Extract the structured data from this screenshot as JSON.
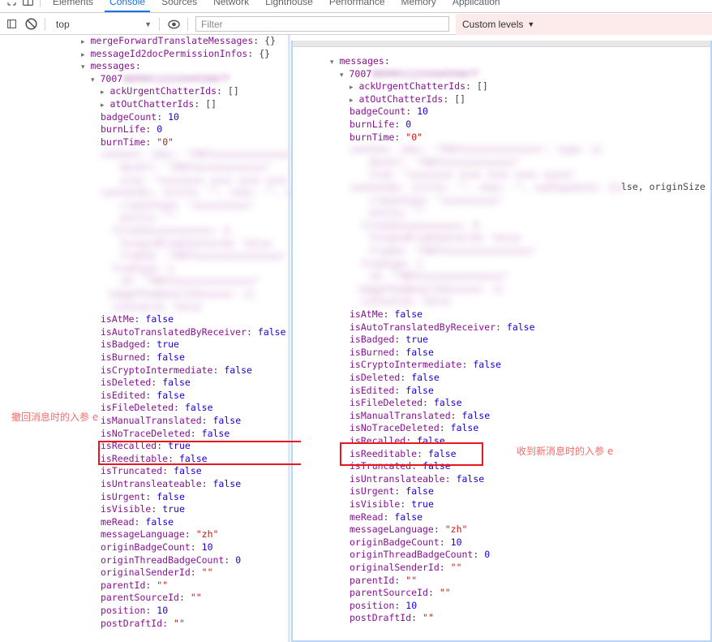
{
  "window": {
    "title": "Chrome DevTools Console"
  },
  "tabs": [
    {
      "label": "Elements",
      "active": false
    },
    {
      "label": "Console",
      "active": true
    },
    {
      "label": "Sources",
      "active": false
    },
    {
      "label": "Network",
      "active": false
    },
    {
      "label": "Lighthouse",
      "active": false
    },
    {
      "label": "Performance",
      "active": false
    },
    {
      "label": "Memory",
      "active": false
    },
    {
      "label": "Application",
      "active": false
    }
  ],
  "toolbar": {
    "clear_icon": "clear-console-icon",
    "context_value": "top",
    "context_caret": "▼",
    "eye_icon": "live-expression-icon",
    "filter_placeholder": "Filter",
    "filter_value": "",
    "levels_label": "Custom levels",
    "levels_caret": "▼",
    "levels_bg": "#fdeaea"
  },
  "colors": {
    "key": "#881391",
    "value_number": "#1c00cf",
    "value_string": "#c41a16",
    "punctuation": "#444444",
    "accent_tab": "#1a73e8",
    "annotation_red": "#f26d6d",
    "highlight_box": "#e8161f",
    "panel_border": "#b6d6f7"
  },
  "annotations": {
    "left": "撤回消息时的入参 e",
    "right": "收到新消息时的入参 e"
  },
  "left_pane": {
    "header_lines": [
      {
        "arrow": "▸",
        "key": "mergeForwardTranslateMessages",
        "value": "{}",
        "value_type": "punc"
      },
      {
        "arrow": "▸",
        "key": "messageId2docPermissionInfos",
        "value": "{}",
        "value_type": "punc"
      },
      {
        "arrow": "▾",
        "key": "messages",
        "value": "",
        "value_type": "none"
      }
    ],
    "message_id_prefix": "7007",
    "message_id_redacted": true,
    "object_lines": [
      {
        "arrow": "▸",
        "key": "ackUrgentChatterIds",
        "value": "[]",
        "value_type": "punc"
      },
      {
        "arrow": "▸",
        "key": "atOutChatterIds",
        "value": "[]",
        "value_type": "punc"
      },
      {
        "arrow": "",
        "key": "badgeCount",
        "value": "10",
        "value_type": "num"
      },
      {
        "arrow": "",
        "key": "burnLife",
        "value": "0",
        "value_type": "num"
      },
      {
        "arrow": "",
        "key": "burnTime",
        "value": "\"0\"",
        "value_type": "str"
      }
    ],
    "redacted_block_lines": 13,
    "visible_properties": [
      {
        "key": "isAtMe",
        "value": "false",
        "value_type": "bool"
      },
      {
        "key": "isAutoTranslatedByReceiver",
        "value": "false",
        "value_type": "bool"
      },
      {
        "key": "isBadged",
        "value": "true",
        "value_type": "bool"
      },
      {
        "key": "isBurned",
        "value": "false",
        "value_type": "bool"
      },
      {
        "key": "isCryptoIntermediate",
        "value": "false",
        "value_type": "bool"
      },
      {
        "key": "isDeleted",
        "value": "false",
        "value_type": "bool"
      },
      {
        "key": "isEdited",
        "value": "false",
        "value_type": "bool"
      },
      {
        "key": "isFileDeleted",
        "value": "false",
        "value_type": "bool"
      },
      {
        "key": "isManualTranslated",
        "value": "false",
        "value_type": "bool"
      },
      {
        "key": "isNoTraceDeleted",
        "value": "false",
        "value_type": "bool"
      },
      {
        "key": "isRecalled",
        "value": "true",
        "value_type": "bool",
        "highlighted": true
      },
      {
        "key": "isReeditable",
        "value": "false",
        "value_type": "bool"
      },
      {
        "key": "isTruncated",
        "value": "false",
        "value_type": "bool"
      },
      {
        "key": "isUntransleateable",
        "value": "false",
        "value_type": "bool"
      },
      {
        "key": "isUrgent",
        "value": "false",
        "value_type": "bool"
      },
      {
        "key": "isVisible",
        "value": "true",
        "value_type": "bool"
      },
      {
        "key": "meRead",
        "value": "false",
        "value_type": "bool"
      },
      {
        "key": "messageLanguage",
        "value": "\"zh\"",
        "value_type": "str"
      },
      {
        "key": "originBadgeCount",
        "value": "10",
        "value_type": "num"
      },
      {
        "key": "originThreadBadgeCount",
        "value": "0",
        "value_type": "num"
      },
      {
        "key": "originalSenderId",
        "value": "\"\"",
        "value_type": "str"
      },
      {
        "key": "parentId",
        "value": "\"\"",
        "value_type": "str"
      },
      {
        "key": "parentSourceId",
        "value": "\"\"",
        "value_type": "str"
      },
      {
        "key": "position",
        "value": "10",
        "value_type": "num"
      },
      {
        "key": "postDraftId",
        "value": "\"\"",
        "value_type": "str"
      }
    ]
  },
  "right_pane": {
    "header_lines": [
      {
        "arrow": "▾",
        "key": "messages",
        "value": "",
        "value_type": "none"
      }
    ],
    "message_id_prefix": "7007",
    "message_id_redacted": true,
    "object_lines": [
      {
        "arrow": "▸",
        "key": "ackUrgentChatterIds",
        "value": "[]",
        "value_type": "punc"
      },
      {
        "arrow": "▸",
        "key": "atOutChatterIds",
        "value": "[]",
        "value_type": "punc"
      },
      {
        "arrow": "",
        "key": "badgeCount",
        "value": "10",
        "value_type": "num"
      },
      {
        "arrow": "",
        "key": "burnLife",
        "value": "0",
        "value_type": "num"
      },
      {
        "arrow": "",
        "key": "burnTime",
        "value": "\"0\"",
        "value_type": "str"
      }
    ],
    "redacted_block_lines": 13,
    "overflow_fragment": "lse, originSize",
    "visible_properties": [
      {
        "key": "isAtMe",
        "value": "false",
        "value_type": "bool"
      },
      {
        "key": "isAutoTranslatedByReceiver",
        "value": "false",
        "value_type": "bool"
      },
      {
        "key": "isBadged",
        "value": "true",
        "value_type": "bool"
      },
      {
        "key": "isBurned",
        "value": "false",
        "value_type": "bool"
      },
      {
        "key": "isCryptoIntermediate",
        "value": "false",
        "value_type": "bool"
      },
      {
        "key": "isDeleted",
        "value": "false",
        "value_type": "bool"
      },
      {
        "key": "isEdited",
        "value": "false",
        "value_type": "bool"
      },
      {
        "key": "isFileDeleted",
        "value": "false",
        "value_type": "bool"
      },
      {
        "key": "isManualTranslated",
        "value": "false",
        "value_type": "bool"
      },
      {
        "key": "isNoTraceDeleted",
        "value": "false",
        "value_type": "bool"
      },
      {
        "key": "isRecalled",
        "value": "false",
        "value_type": "bool",
        "highlighted": true
      },
      {
        "key": "isReeditable",
        "value": "false",
        "value_type": "bool"
      },
      {
        "key": "isTruncated",
        "value": "false",
        "value_type": "bool"
      },
      {
        "key": "isUntranslateable",
        "value": "false",
        "value_type": "bool"
      },
      {
        "key": "isUrgent",
        "value": "false",
        "value_type": "bool"
      },
      {
        "key": "isVisible",
        "value": "true",
        "value_type": "bool"
      },
      {
        "key": "meRead",
        "value": "false",
        "value_type": "bool"
      },
      {
        "key": "messageLanguage",
        "value": "\"zh\"",
        "value_type": "str"
      },
      {
        "key": "originBadgeCount",
        "value": "10",
        "value_type": "num"
      },
      {
        "key": "originThreadBadgeCount",
        "value": "0",
        "value_type": "num"
      },
      {
        "key": "originalSenderId",
        "value": "\"\"",
        "value_type": "str"
      },
      {
        "key": "parentId",
        "value": "\"\"",
        "value_type": "str"
      },
      {
        "key": "parentSourceId",
        "value": "\"\"",
        "value_type": "str"
      },
      {
        "key": "position",
        "value": "10",
        "value_type": "num"
      },
      {
        "key": "postDraftId",
        "value": "\"\"",
        "value_type": "str"
      }
    ]
  },
  "redacted_placeholder_text": [
    "content: {doc: \"7007xxxxxxxxxxxxxx\", type: 1}",
    "  docUrl: \"7007xxxxxxxxxxxxx\"",
    "  size: \"xxxxxxxx xxxx xxxx xxxx xxxxx\"",
    "contentEx: {title: \"\", chat: \"\", subTypeInfo: {}}",
    "  createType: \"xxxxxxxxxx\"",
    "  entity: \"\"",
    "  fileIdxxxxxxxxxxxx: 0",
    "  forwardFromChatterId: false",
    "  fromId: \"7007xxxxxxxxxxxxxxxx\"",
    "  fromType: 1",
    "  id: \"7007xxxxxxxxxxxxxxx\"",
    "imageThumbnailIdxxxxxx: {}",
    "  isInvalid: false"
  ]
}
